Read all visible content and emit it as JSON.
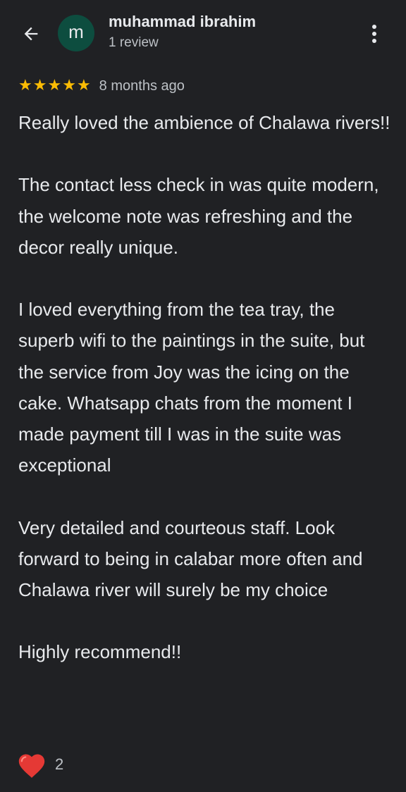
{
  "header": {
    "avatar_letter": "m",
    "user_name": "muhammad ibrahim",
    "review_count": "1 review",
    "back_icon": "arrow-back-icon",
    "menu_icon": "more-vert-icon"
  },
  "review": {
    "rating": 5,
    "stars": [
      "★",
      "★",
      "★",
      "★",
      "★"
    ],
    "time_ago": "8 months ago",
    "paragraphs": [
      "Really loved the ambience of Chalawa rivers!!",
      "The contact less check in was quite modern, the welcome note was refreshing and the decor really unique.",
      "I loved everything from the tea tray, the superb wifi to the paintings in the suite, but the service from Joy was the icing on the cake. Whatsapp chats from the moment I made payment till I was in the suite was exceptional",
      "Very detailed and courteous staff. Look forward to being in calabar more often and Chalawa river will surely be my choice",
      "Highly recommend!!"
    ]
  },
  "reactions": {
    "heart_icon": "heart-icon",
    "count": "2"
  },
  "colors": {
    "background": "#202124",
    "text": "#e8eaed",
    "secondary_text": "#bdc1c6",
    "avatar_bg": "#0d4d3f",
    "star": "#fbbc04",
    "heart": "#e53935"
  }
}
